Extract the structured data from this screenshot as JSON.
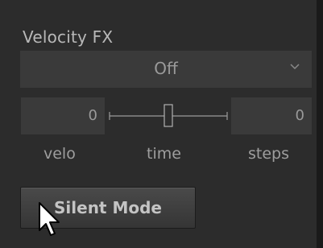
{
  "section": {
    "title": "Velocity FX"
  },
  "dropdown": {
    "value": "Off",
    "icon": "chevron-down-icon"
  },
  "velo": {
    "value": "0",
    "label": "velo"
  },
  "time": {
    "label": "time",
    "position": 0.5
  },
  "steps": {
    "value": "0",
    "label": "steps"
  },
  "silent_mode": {
    "label": "Silent Mode"
  },
  "colors": {
    "background": "#2c2c2c",
    "field": "#3a3a3a",
    "text": "#b8b8b8"
  }
}
